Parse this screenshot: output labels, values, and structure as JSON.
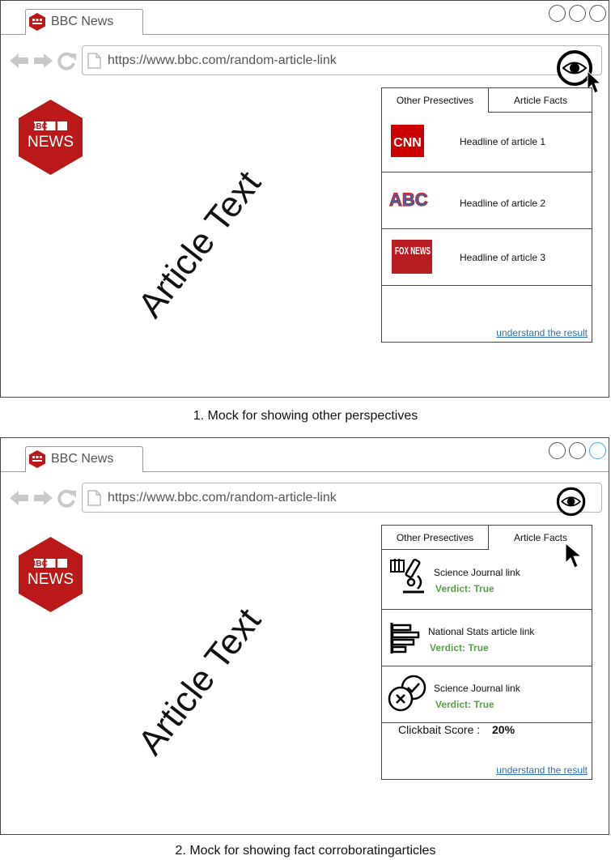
{
  "mocks": [
    {
      "browser": {
        "tab_title": "BBC News",
        "url": "https://www.bbc.com/random-article-link"
      },
      "logo": {
        "line1": "BBC",
        "line2": "NEWS"
      },
      "article_text": "Article Text",
      "panel": {
        "tab_perspectives": "Other Presectives",
        "tab_facts": "Article Facts",
        "active_tab": "Other Presectives",
        "items": [
          {
            "source": "CNN",
            "icon": "cnn-logo",
            "headline": "Headline of article 1"
          },
          {
            "source": "ABC",
            "icon": "abc-logo",
            "headline": "Headline of article 2"
          },
          {
            "source": "FOX NEWS",
            "icon": "fox-news-logo",
            "headline": "Headline of article 3"
          }
        ],
        "understand_link": "understand the result"
      },
      "caption": "1. Mock for showing other perspectives"
    },
    {
      "browser": {
        "tab_title": "BBC News",
        "url": "https://www.bbc.com/random-article-link"
      },
      "logo": {
        "line1": "BBC",
        "line2": "NEWS"
      },
      "article_text": "Article Text",
      "panel": {
        "tab_perspectives": "Other Presectives",
        "tab_facts": "Article Facts",
        "active_tab": "Article Facts",
        "items": [
          {
            "icon": "microscope-icon",
            "title": "Science Journal link",
            "verdict": "Verdict: True"
          },
          {
            "icon": "bar-chart-icon",
            "title": "National Stats article link",
            "verdict": "Verdict: True"
          },
          {
            "icon": "check-cross-icon",
            "title": "Science Journal link",
            "verdict": "Verdict: True"
          }
        ],
        "clickbait_label": "Clickbait Score :",
        "clickbait_value": "20%",
        "understand_link": "understand the result"
      },
      "caption": "2. Mock for showing fact corroboratingarticles"
    }
  ],
  "colors": {
    "bbc_red": "#bb1919",
    "verdict_green": "#5a9e4b",
    "link_blue": "#2a6fba",
    "active_window_control": "#4aa8d8"
  }
}
